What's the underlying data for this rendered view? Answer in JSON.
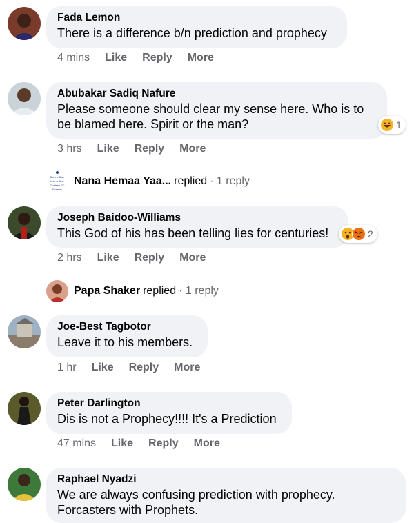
{
  "comments": [
    {
      "author": "Fada Lemon",
      "text": "There is a difference b/n prediction and prophecy",
      "time": "4 mins",
      "like": "Like",
      "reply": "Reply",
      "more": "More"
    },
    {
      "author": "Abubakar Sadiq Nafure",
      "text_line1": "Please someone should clear my sense here. Who is to",
      "text_line2": "be blamed here. Spirit or the man?",
      "time": "3 hrs",
      "like": "Like",
      "reply": "Reply",
      "more": "More",
      "reaction_count": "1",
      "reactions": [
        "laugh-emoji-icon"
      ],
      "replies": {
        "name": "Nana Hemaa Yaa...",
        "word": "replied",
        "count": "· 1 reply",
        "avatar_text": [
          "Born a Blue",
          "Live a Blue",
          "Chelsea FC",
          "Forever"
        ]
      }
    },
    {
      "author": "Joseph Baidoo-Williams",
      "text": "This God of his has been telling lies for centuries!",
      "time": "2 hrs",
      "like": "Like",
      "reply": "Reply",
      "more": "More",
      "reaction_count": "2",
      "reactions": [
        "wow-emoji-icon",
        "angry-emoji-icon"
      ],
      "replies": {
        "name": "Papa Shaker",
        "word": "replied",
        "count": "· 1 reply"
      }
    },
    {
      "author": "Joe-Best Tagbotor",
      "text": "Leave it to his members.",
      "time": "1 hr",
      "like": "Like",
      "reply": "Reply",
      "more": "More"
    },
    {
      "author": "Peter Darlington",
      "text": "Dis is not a Prophecy!!!! It's a Prediction",
      "time": "47 mins",
      "like": "Like",
      "reply": "Reply",
      "more": "More"
    },
    {
      "author": "Raphael Nyadzi",
      "text_line1": "We are always confusing prediction with prophecy.",
      "text_line2": "Forcasters with Prophets."
    }
  ],
  "colors": {
    "bubble": "#f0f2f5",
    "meta": "#65676b",
    "text": "#050505"
  }
}
